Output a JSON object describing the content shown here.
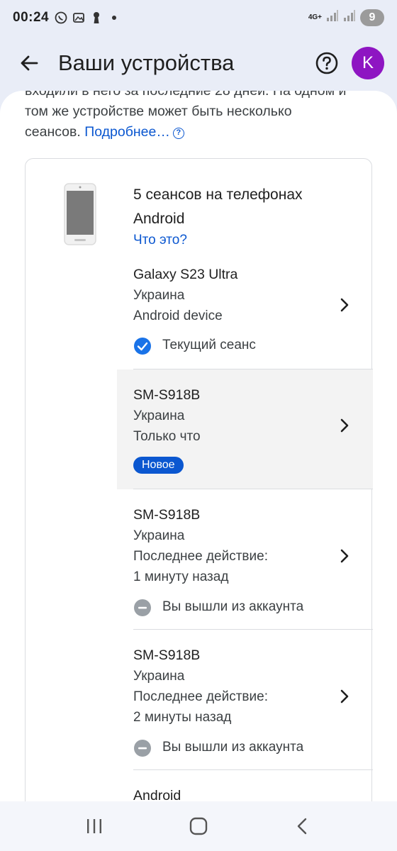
{
  "status_bar": {
    "time": "00:24",
    "network_label": "4G+",
    "battery": "9",
    "icons": [
      "viber-icon",
      "gallery-icon",
      "keyhole-icon",
      "dot-icon",
      "signal-icon",
      "signal-icon"
    ]
  },
  "header": {
    "title": "Ваши устройства",
    "avatar_letter": "K",
    "avatar_color": "#8e15c2"
  },
  "intro": {
    "clipped_line": "входили в него за последние 28 дней. На одном и",
    "line1": "том же устройстве может быть несколько",
    "line2": "сеансов.",
    "link": "Подробнее…"
  },
  "device_group": {
    "title": "5 сеансов на телефонах Android",
    "what_link": "Что это?"
  },
  "sessions": [
    {
      "name": "Galaxy S23 Ultra",
      "location": "Украина",
      "line3": "Android device",
      "state": "Текущий сеанс"
    },
    {
      "name": "SM-S918B",
      "location": "Украина",
      "line3": "Только что",
      "badge": "Новое"
    },
    {
      "name": "SM-S918B",
      "location": "Украина",
      "line3": "Последнее действие:",
      "line4": "1 минуту назад",
      "state": "Вы вышли из аккаунта"
    },
    {
      "name": "SM-S918B",
      "location": "Украина",
      "line3": "Последнее действие:",
      "line4": "2 минуты назад",
      "state": "Вы вышли из аккаунта"
    },
    {
      "name": "Android"
    }
  ],
  "colors": {
    "accent": "#0b57d0",
    "header_bg": "#e9edf7",
    "highlight_row": "#f3f3f3"
  }
}
